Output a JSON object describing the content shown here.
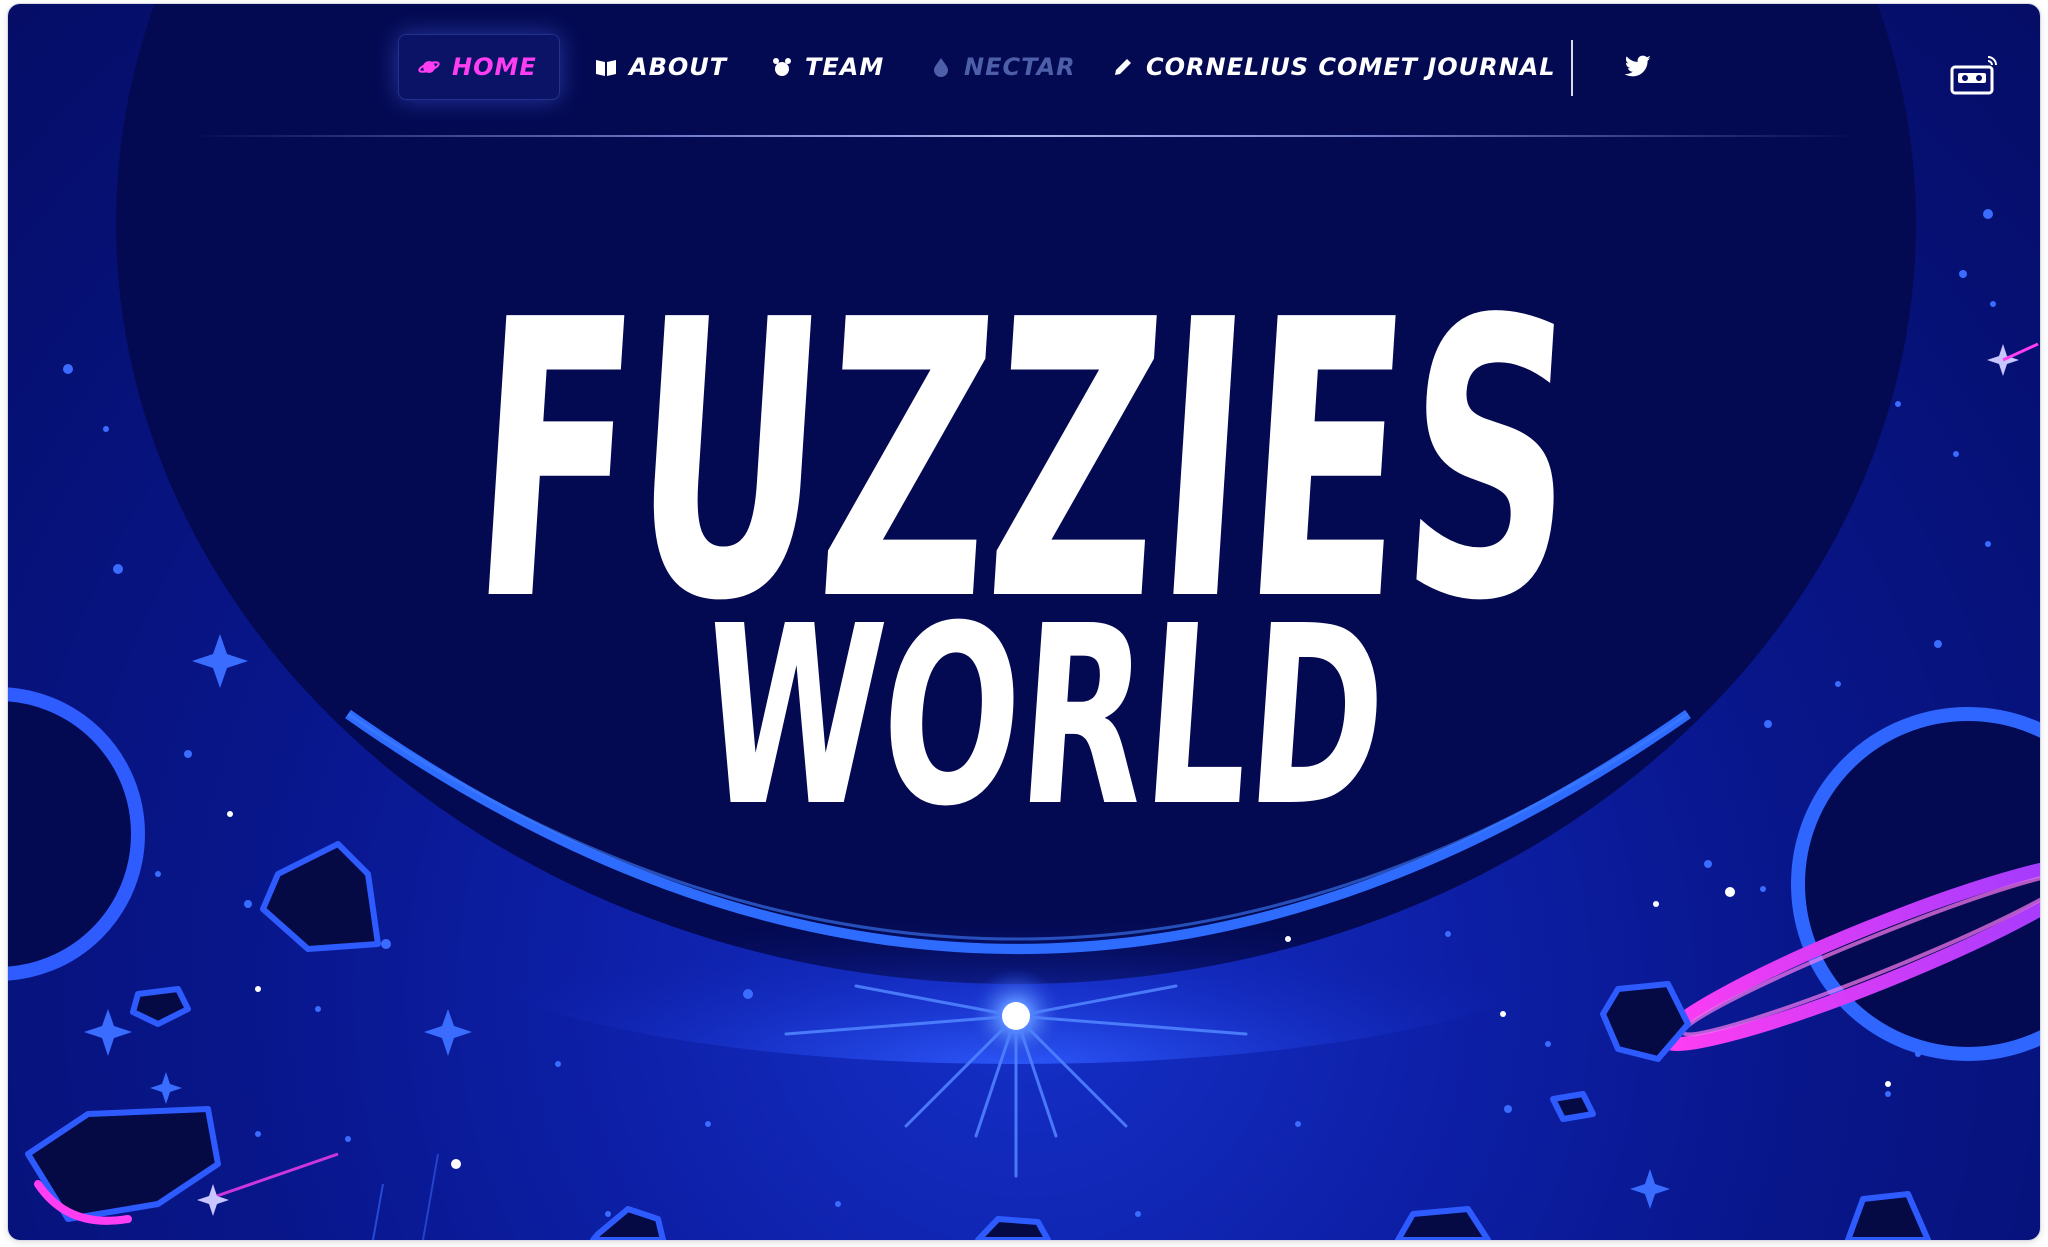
{
  "nav": {
    "items": [
      {
        "label": "HOME",
        "icon": "planet-icon",
        "active": true,
        "color": "#ff3df2"
      },
      {
        "label": "ABOUT",
        "icon": "book-icon"
      },
      {
        "label": "TEAM",
        "icon": "bear-icon"
      },
      {
        "label": "NECTAR",
        "icon": "droplet-icon",
        "disabled": true,
        "color": "#4c5fa8"
      },
      {
        "label": "CORNELIUS COMET JOURNAL",
        "icon": "pencil-icon"
      }
    ],
    "social": [
      {
        "icon": "twitter-icon"
      }
    ],
    "extra": [
      {
        "icon": "cassette-radio-icon"
      }
    ]
  },
  "hero": {
    "title_line1": "FUZZIES",
    "title_line2": "WORLD"
  },
  "colors": {
    "background_dark": "#050d66",
    "background_blue": "#1530c8",
    "arc_glow": "#2f6bff",
    "accent_pink": "#ff3df2",
    "title": "#ffffff"
  }
}
